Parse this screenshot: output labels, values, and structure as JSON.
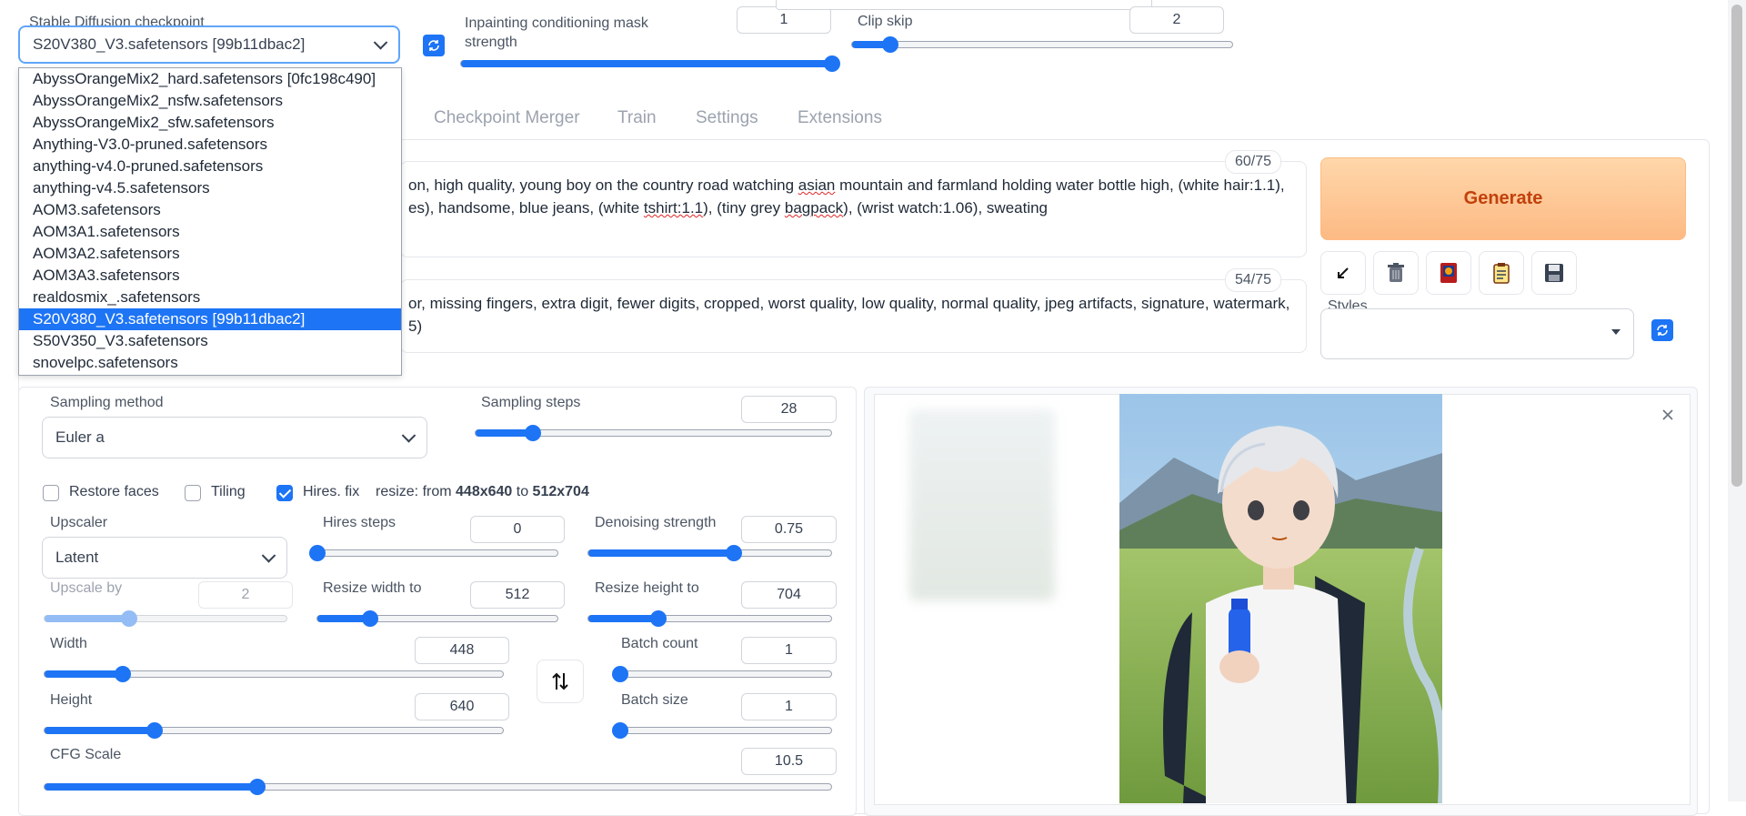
{
  "checkpoint": {
    "label": "Stable Diffusion checkpoint",
    "selected": "S20V380_V3.safetensors [99b11dbac2]",
    "options": [
      {
        "label": "AbyssOrangeMix2_hard.safetensors [0fc198c490]"
      },
      {
        "label": "AbyssOrangeMix2_nsfw.safetensors"
      },
      {
        "label": "AbyssOrangeMix2_sfw.safetensors"
      },
      {
        "label": "Anything-V3.0-pruned.safetensors"
      },
      {
        "label": "anything-v4.0-pruned.safetensors"
      },
      {
        "label": "anything-v4.5.safetensors"
      },
      {
        "label": "AOM3.safetensors"
      },
      {
        "label": "AOM3A1.safetensors"
      },
      {
        "label": "AOM3A2.safetensors"
      },
      {
        "label": "AOM3A3.safetensors"
      },
      {
        "label": "realdosmix_.safetensors"
      },
      {
        "label": "S20V380_V3.safetensors [99b11dbac2]",
        "selected": true
      },
      {
        "label": "S50V350_V3.safetensors"
      },
      {
        "label": "snovelpc.safetensors"
      }
    ]
  },
  "inpainting": {
    "label": "Inpainting conditioning mask strength",
    "value": "1",
    "fraction": 1.0
  },
  "clip_skip": {
    "label": "Clip skip",
    "value": "2",
    "fraction": 0.1
  },
  "tabs": [
    {
      "label": "Checkpoint Merger"
    },
    {
      "label": "Train"
    },
    {
      "label": "Settings"
    },
    {
      "label": "Extensions"
    }
  ],
  "prompt": {
    "counter": "60/75",
    "line1_a": "on, high quality, young boy on the country road watching ",
    "line1_b": "asian",
    "line1_c": " mountain and farmland holding water bottle high, (white hair:1.1),",
    "line2_a": "es), handsome, blue jeans, (white ",
    "line2_b": "tshirt:1.1",
    "line2_c": "), (tiny grey ",
    "line2_d": "bagpack",
    "line2_e": "), (wrist watch:1.06), sweating"
  },
  "negative_prompt": {
    "counter": "54/75",
    "line1": "or, missing fingers, extra digit, fewer digits, cropped, worst quality, low quality, normal quality, jpeg artifacts, signature, watermark,",
    "line2": "5)"
  },
  "generate_label": "Generate",
  "toolbar_icons": [
    "arrow-icon",
    "trash-icon",
    "card-icon",
    "clipboard-icon",
    "save-icon"
  ],
  "styles": {
    "label": "Styles",
    "value": ""
  },
  "sampling_method": {
    "label": "Sampling method",
    "value": "Euler a"
  },
  "sampling_steps": {
    "label": "Sampling steps",
    "value": "28",
    "fraction": 0.18
  },
  "restore_faces": {
    "label": "Restore faces",
    "checked": false
  },
  "tiling": {
    "label": "Tiling",
    "checked": false
  },
  "hires_fix": {
    "label": "Hires. fix",
    "checked": true
  },
  "resize_info": {
    "prefix": "resize: from ",
    "from": "448x640",
    "mid": " to ",
    "to": "512x704"
  },
  "upscaler": {
    "label": "Upscaler",
    "value": "Latent"
  },
  "hires_steps": {
    "label": "Hires steps",
    "value": "0",
    "fraction": 0.0
  },
  "denoising": {
    "label": "Denoising strength",
    "value": "0.75",
    "fraction": 0.73
  },
  "upscale_by": {
    "label": "Upscale by",
    "value": "2",
    "fraction": 0.35
  },
  "resize_width": {
    "label": "Resize width to",
    "value": "512",
    "fraction": 0.27
  },
  "resize_height": {
    "label": "Resize height to",
    "value": "704",
    "fraction": 0.35
  },
  "width": {
    "label": "Width",
    "value": "448",
    "fraction": 0.2
  },
  "height": {
    "label": "Height",
    "value": "640",
    "fraction": 0.3
  },
  "batch_count": {
    "label": "Batch count",
    "value": "1",
    "fraction": 0.0
  },
  "batch_size": {
    "label": "Batch size",
    "value": "1",
    "fraction": 0.0
  },
  "cfg_scale": {
    "label": "CFG Scale",
    "value": "10.5",
    "fraction": 0.33
  },
  "colors": {
    "accent": "#1d74f5",
    "generate_bg": "#fdba84",
    "generate_text": "#c2410c"
  }
}
